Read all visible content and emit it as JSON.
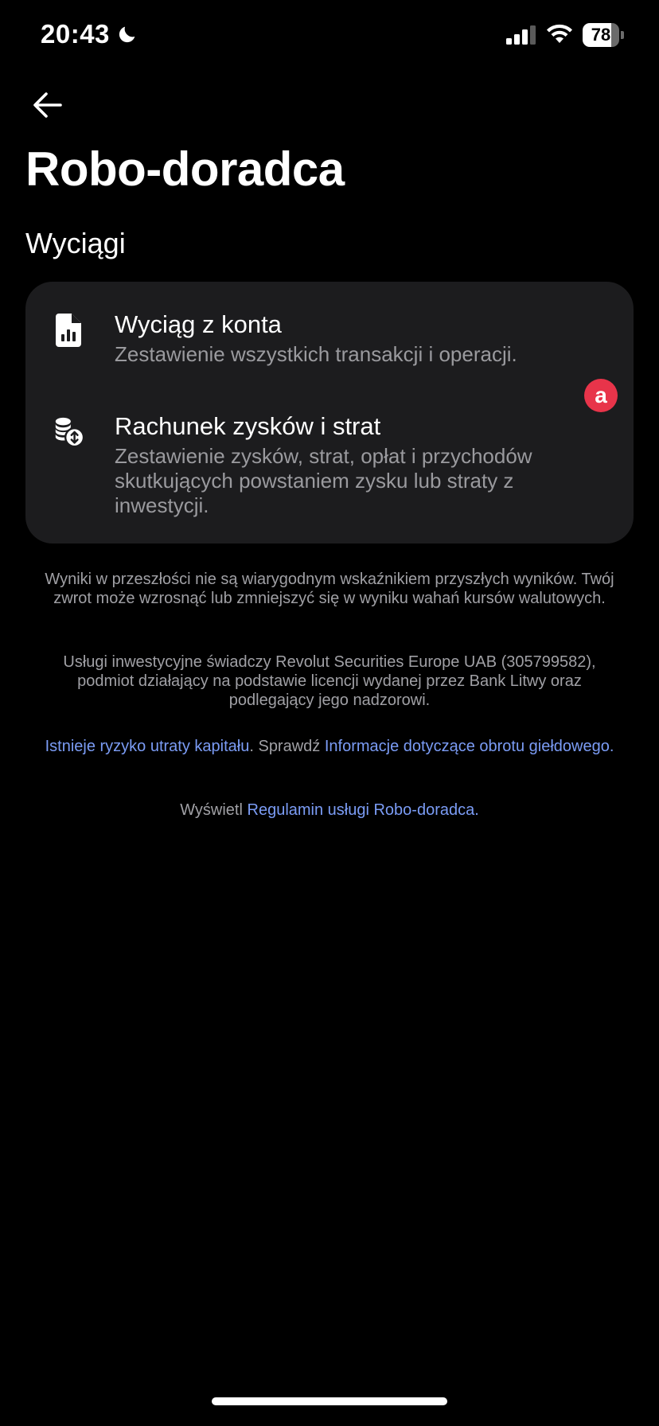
{
  "status_bar": {
    "time": "20:43",
    "battery": "78"
  },
  "header": {
    "title": "Robo-doradca"
  },
  "section": {
    "title": "Wyciągi"
  },
  "statements": [
    {
      "icon": "document-chart-icon",
      "title": "Wyciąg z konta",
      "subtitle": "Zestawienie wszystkich transakcji i operacji."
    },
    {
      "icon": "coins-exchange-icon",
      "title": "Rachunek zysków i strat",
      "subtitle": "Zestawienie zysków, strat, opłat i przychodów skutkujących powstaniem zysku lub straty z inwestycji.",
      "badge": "a"
    }
  ],
  "disclaimers": {
    "past_results": "Wyniki w przeszłości nie są wiarygodnym wskaźnikiem przyszłych wyników. Twój zwrot może wzrosnąć lub zmniejszyć się w wyniku wahań kursów walutowych.",
    "services": "Usługi inwestycyjne świadczy Revolut Securities Europe UAB (305799582), podmiot działający na podstawie licencji wydanej przez Bank Litwy oraz podlegający jego nadzorowi.",
    "risk_link": "Istnieje ryzyko utraty kapitału",
    "risk_mid": ". Sprawdź ",
    "info_link": "Informacje dotyczące obrotu giełdowego",
    "info_end": ".",
    "terms_prefix": "Wyświetl ",
    "terms_link": "Regulamin usługi Robo-doradca."
  },
  "colors": {
    "background": "#000000",
    "card": "#1c1c1e",
    "link": "#7b9cf5",
    "badge": "#e8344a"
  }
}
